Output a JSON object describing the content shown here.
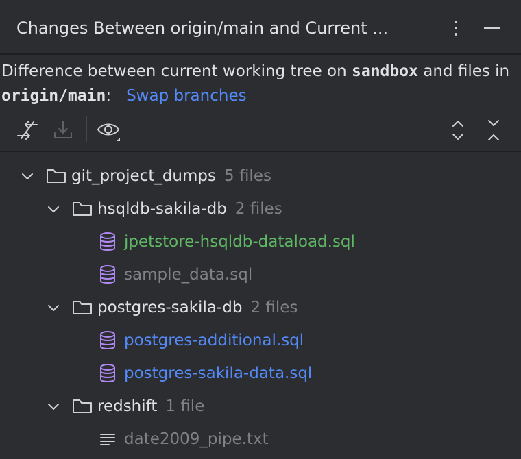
{
  "panel": {
    "title": "Changes Between origin/main and Current ..."
  },
  "description": {
    "prefix": "Difference between current working tree on ",
    "current_branch": "sandbox",
    "middle": " and files in ",
    "target_branch": "origin/main",
    "suffix": ":",
    "swap_link": "Swap branches"
  },
  "toolbar": {
    "icons": [
      "compare-arrows-icon",
      "download-icon",
      "eye-icon",
      "expand-all-icon",
      "collapse-all-icon"
    ]
  },
  "colors": {
    "added": "#5fb865",
    "modified": "#548af7",
    "unchanged": "#7f8187",
    "sql_icon": "#b189f5"
  },
  "tree": {
    "root": {
      "name": "git_project_dumps",
      "count": "5 files"
    },
    "folders": [
      {
        "name": "hsqldb-sakila-db",
        "count": "2 files",
        "files": [
          {
            "name": "jpetstore-hsqldb-dataload.sql",
            "status": "added",
            "icon": "database-icon"
          },
          {
            "name": "sample_data.sql",
            "status": "unchanged",
            "icon": "database-icon"
          }
        ]
      },
      {
        "name": "postgres-sakila-db",
        "count": "2 files",
        "files": [
          {
            "name": "postgres-additional.sql",
            "status": "modified",
            "icon": "database-icon"
          },
          {
            "name": "postgres-sakila-data.sql",
            "status": "modified",
            "icon": "database-icon"
          }
        ]
      },
      {
        "name": "redshift",
        "count": "1 file",
        "files": [
          {
            "name": "date2009_pipe.txt",
            "status": "unchanged",
            "icon": "text-file-icon"
          }
        ]
      }
    ]
  }
}
